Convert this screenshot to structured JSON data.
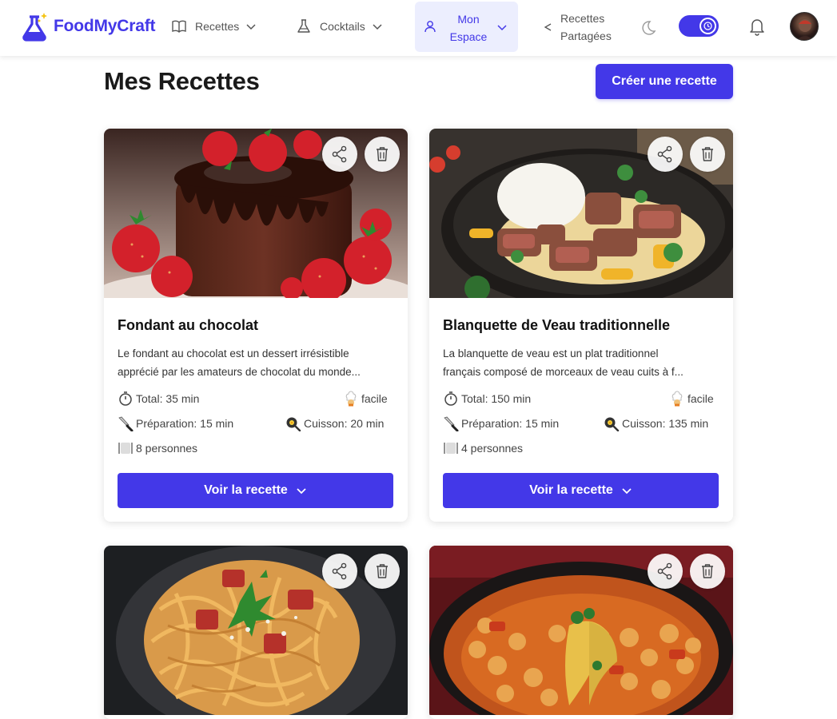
{
  "brand": {
    "name": "FoodMyCraft"
  },
  "nav": {
    "recettes": "Recettes",
    "cocktails": "Cocktails",
    "espace_line1": "Mon",
    "espace_line2": "Espace",
    "shared_line1": "Recettes",
    "shared_line2": "Partagées"
  },
  "colors": {
    "accent": "#4338e8",
    "accent_light": "#eceefe"
  },
  "page": {
    "title": "Mes Recettes",
    "create_button": "Créer une recette"
  },
  "recipes": [
    {
      "title": "Fondant au chocolat",
      "desc_line1": "Le fondant au chocolat est un dessert irrésistible",
      "desc_line2": "apprécié par les amateurs de chocolat du monde...",
      "total": "Total: 35 min",
      "difficulty": "facile",
      "prep": "Préparation: 15 min",
      "cook": "Cuisson: 20 min",
      "servings": "8 personnes",
      "button": "Voir la recette",
      "image_icon": "chocolate-fondant-photo"
    },
    {
      "title": "Blanquette de Veau traditionnelle",
      "desc_line1": "La blanquette de veau est un plat traditionnel",
      "desc_line2": "français composé de morceaux de veau cuits à f...",
      "total": "Total: 150 min",
      "difficulty": "facile",
      "prep": "Préparation: 15 min",
      "cook": "Cuisson: 135 min",
      "servings": "4 personnes",
      "button": "Voir la recette",
      "image_icon": "blanquette-photo"
    },
    {
      "image_icon": "spaghetti-photo"
    },
    {
      "image_icon": "chickpea-stew-photo"
    }
  ]
}
